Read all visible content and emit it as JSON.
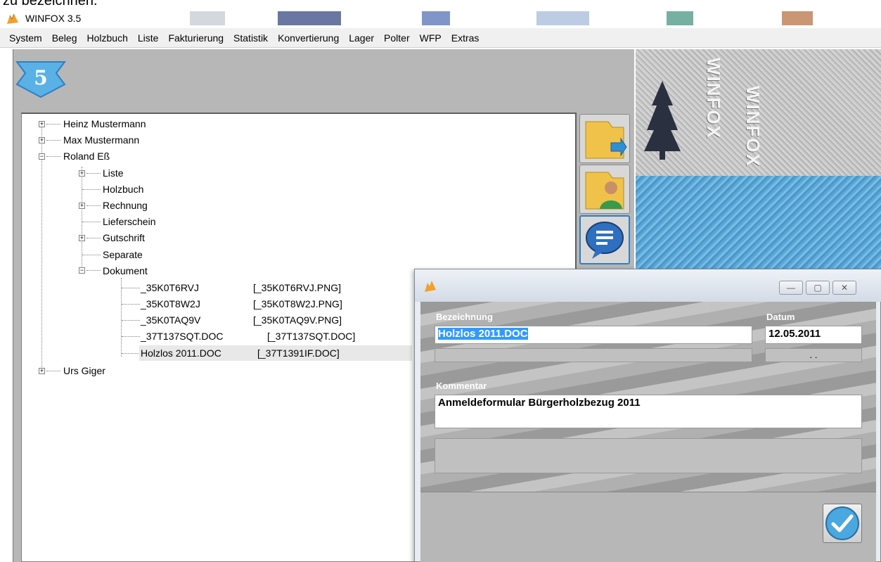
{
  "page": {
    "cropped_caption": "zu bezeichnen."
  },
  "window": {
    "title": "WINFOX 3.5"
  },
  "menu": {
    "items": [
      "System",
      "Beleg",
      "Holzbuch",
      "Liste",
      "Fakturierung",
      "Statistik",
      "Konvertierung",
      "Lager",
      "Polter",
      "WFP",
      "Extras"
    ]
  },
  "badge": {
    "number": "5"
  },
  "tree": {
    "nodes": [
      {
        "label": "Heinz Mustermann",
        "expander": "+"
      },
      {
        "label": "Max Mustermann",
        "expander": "+"
      },
      {
        "label": "Roland Eß",
        "expander": "−"
      },
      {
        "label": "Liste",
        "expander": "+"
      },
      {
        "label": "Holzbuch",
        "expander": ""
      },
      {
        "label": "Rechnung",
        "expander": "+"
      },
      {
        "label": "Lieferschein",
        "expander": ""
      },
      {
        "label": "Gutschrift",
        "expander": "+"
      },
      {
        "label": "Separate",
        "expander": ""
      },
      {
        "label": "Dokument",
        "expander": "−"
      },
      {
        "label": "_35K0T6RVJ",
        "file": "[_35K0T6RVJ.PNG]"
      },
      {
        "label": "_35K0T8W2J",
        "file": "[_35K0T8W2J.PNG]"
      },
      {
        "label": "_35K0TAQ9V",
        "file": "[_35K0TAQ9V.PNG]"
      },
      {
        "label": "_37T137SQT.DOC",
        "file": "[_37T137SQT.DOC]"
      },
      {
        "label": "Holzlos 2011.DOC",
        "file": "[_37T1391IF.DOC]"
      },
      {
        "label": "Urs Giger",
        "expander": "+"
      }
    ]
  },
  "watermark": {
    "text": "WINFOX"
  },
  "dialog": {
    "minimize": "—",
    "maximize": "▢",
    "close": "✕",
    "bezeichnung_label": "Bezeichnung",
    "bezeichnung_value": "Holzlos 2011.DOC",
    "datum_label": "Datum",
    "datum_value": "12.05.2011",
    "datum_sub": ". .",
    "kommentar_label": "Kommentar",
    "kommentar_value": "Anmeldeformular Bürgerholzbezug 2011"
  },
  "colors": {
    "selection": "#3399ff",
    "panel_gray": "#b7b7b7",
    "dialog_bg": "#e9ecf0",
    "accent_blue": "#2f7fc3"
  },
  "icons": {
    "app": "fox-icon",
    "folder_arrow": "folder-arrow-icon",
    "folder_user": "folder-user-icon",
    "speech_bubble": "speech-bubble-icon",
    "ok": "checkmark-icon"
  }
}
